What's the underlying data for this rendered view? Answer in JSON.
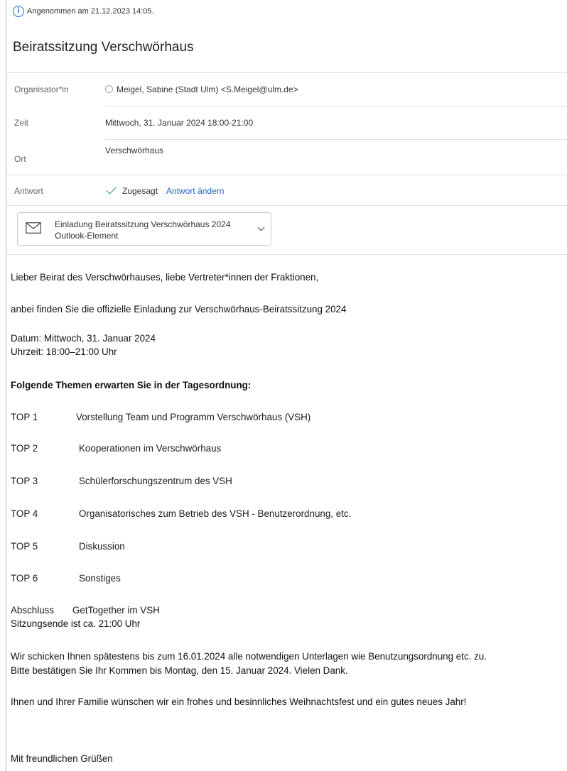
{
  "status": {
    "text": "Angenommen am 21.12.2023 14:05."
  },
  "subject": "Beiratssitzung Verschwörhaus",
  "meta": {
    "organizer_label": "Organisator*in",
    "organizer_value": "Meigel, Sabine (Stadt Ulm) <S.Meigel@ulm.de>",
    "time_label": "Zeit",
    "time_value": "Mittwoch, 31. Januar 2024 18:00-21:00",
    "location_label": "Ort",
    "location_value": "Verschwörhaus",
    "response_label": "Antwort",
    "response_value": "Zugesagt",
    "response_change": "Antwort ändern"
  },
  "attachment": {
    "title": "Einladung Beiratssitzung Verschwörhaus 2024",
    "type": "Outlook-Element",
    "icon": "envelope-icon"
  },
  "body": {
    "greeting": "Lieber Beirat des Verschwörhauses, liebe Vertreter*innen der Fraktionen,",
    "intro": "anbei finden Sie die offizielle Einladung zur Verschwörhaus-Beiratssitzung 2024",
    "date": "Datum: Mittwoch, 31. Januar 2024",
    "time": "Uhrzeit: 18:00–21:00 Uhr",
    "agenda_heading": "Folgende Themen erwarten Sie in der Tagesordnung:",
    "agenda": [
      {
        "num": "TOP 1",
        "text": "Vorstellung Team und Programm Verschwörhaus (VSH)"
      },
      {
        "num": "TOP 2",
        "text": "Kooperationen im Verschwörhaus"
      },
      {
        "num": "TOP 3",
        "text": "Schülerforschungszentrum des VSH"
      },
      {
        "num": "TOP 4",
        "text": "Organisatorisches zum Betrieb des VSH - Benutzerordnung, etc."
      },
      {
        "num": "TOP 5",
        "text": "Diskussion"
      },
      {
        "num": "TOP 6",
        "text": "Sonstiges"
      }
    ],
    "closing_label": "Abschluss",
    "closing_text": "GetTogether im VSH",
    "end_time": "Sitzungsende ist ca. 21:00 Uhr",
    "docs_line1": "Wir schicken Ihnen spätestens bis zum 16.01.2024 alle notwendigen Unterlagen wie Benutzungsordnung etc. zu.",
    "docs_line2": "Bitte bestätigen Sie Ihr Kommen bis Montag, den 15. Januar 2024. Vielen Dank.",
    "wishes": "Ihnen und Ihrer Familie wünschen wir ein frohes und besinnliches Weihnachtsfest und ein gutes neues Jahr!",
    "regards": "Mit freundlichen Grüßen"
  },
  "colors": {
    "accent": "#1f62c2",
    "accepted": "#2e9d3e"
  }
}
